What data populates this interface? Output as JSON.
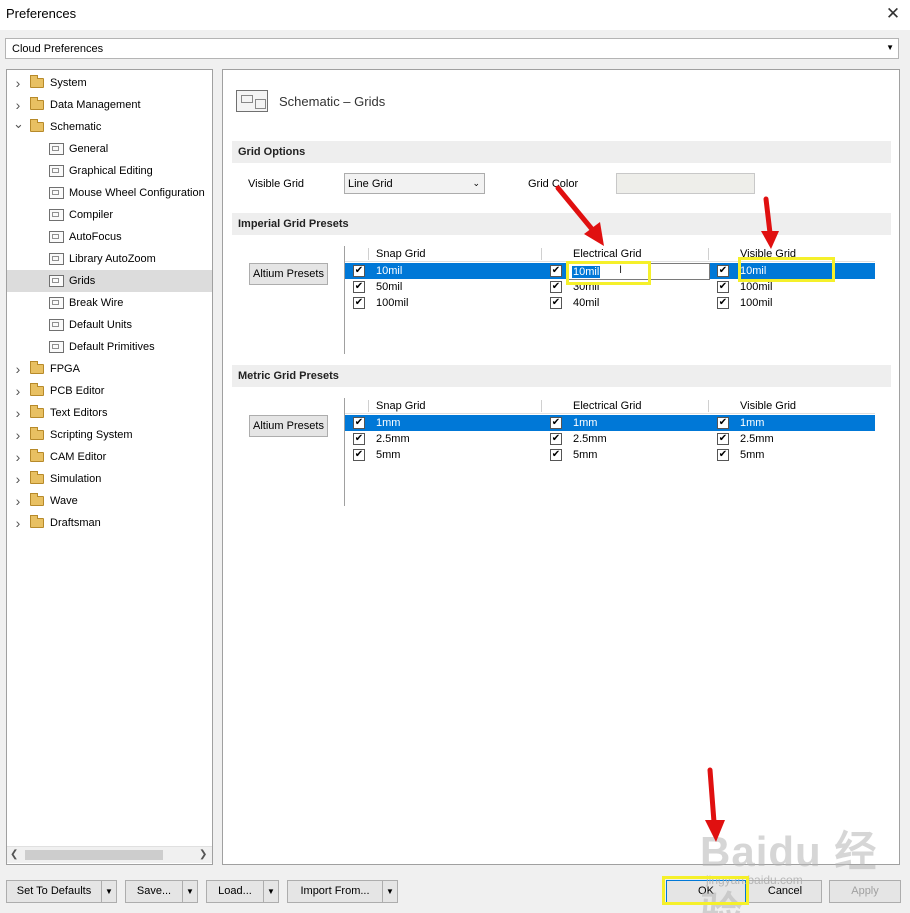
{
  "window": {
    "title": "Preferences",
    "close_glyph": "✕"
  },
  "cloud_select": {
    "value": "Cloud Preferences"
  },
  "tree": {
    "items": [
      {
        "label": "System",
        "level": 0,
        "expanded": false
      },
      {
        "label": "Data Management",
        "level": 0,
        "expanded": false
      },
      {
        "label": "Schematic",
        "level": 0,
        "expanded": true
      },
      {
        "label": "General",
        "level": 1
      },
      {
        "label": "Graphical Editing",
        "level": 1
      },
      {
        "label": "Mouse Wheel Configuration",
        "level": 1
      },
      {
        "label": "Compiler",
        "level": 1
      },
      {
        "label": "AutoFocus",
        "level": 1
      },
      {
        "label": "Library AutoZoom",
        "level": 1
      },
      {
        "label": "Grids",
        "level": 1,
        "selected": true
      },
      {
        "label": "Break Wire",
        "level": 1
      },
      {
        "label": "Default Units",
        "level": 1
      },
      {
        "label": "Default Primitives",
        "level": 1
      },
      {
        "label": "FPGA",
        "level": 0,
        "expanded": false
      },
      {
        "label": "PCB Editor",
        "level": 0,
        "expanded": false
      },
      {
        "label": "Text Editors",
        "level": 0,
        "expanded": false
      },
      {
        "label": "Scripting System",
        "level": 0,
        "expanded": false
      },
      {
        "label": "CAM Editor",
        "level": 0,
        "expanded": false
      },
      {
        "label": "Simulation",
        "level": 0,
        "expanded": false
      },
      {
        "label": "Wave",
        "level": 0,
        "expanded": false
      },
      {
        "label": "Draftsman",
        "level": 0,
        "expanded": false
      }
    ]
  },
  "page": {
    "title": "Schematic – Grids"
  },
  "grid_options": {
    "header": "Grid Options",
    "visible_grid_label": "Visible Grid",
    "visible_grid_value": "Line Grid",
    "grid_color_label": "Grid Color",
    "grid_color": "#eeeeea"
  },
  "imperial": {
    "header": "Imperial Grid Presets",
    "presets_button": "Altium Presets",
    "columns": [
      "Snap Grid",
      "Electrical Grid",
      "Visible Grid"
    ],
    "rows": [
      {
        "snap": "10mil",
        "electrical": "10mil",
        "visible": "10mil",
        "selected": true
      },
      {
        "snap": "50mil",
        "electrical": "30mil",
        "visible": "100mil"
      },
      {
        "snap": "100mil",
        "electrical": "40mil",
        "visible": "100mil"
      }
    ]
  },
  "metric": {
    "header": "Metric Grid Presets",
    "presets_button": "Altium Presets",
    "columns": [
      "Snap Grid",
      "Electrical Grid",
      "Visible Grid"
    ],
    "rows": [
      {
        "snap": "1mm",
        "electrical": "1mm",
        "visible": "1mm",
        "selected": true
      },
      {
        "snap": "2.5mm",
        "electrical": "2.5mm",
        "visible": "2.5mm"
      },
      {
        "snap": "5mm",
        "electrical": "5mm",
        "visible": "5mm"
      }
    ]
  },
  "buttons": {
    "set_defaults": "Set To Defaults",
    "save": "Save...",
    "load": "Load...",
    "import_from": "Import From...",
    "ok": "OK",
    "cancel": "Cancel",
    "apply": "Apply"
  },
  "watermark": {
    "text": "Baidu 经验",
    "url": "jingyan.baidu.com"
  },
  "colors": {
    "selection": "#0078d7",
    "highlight": "#f5f02a",
    "arrow": "#e01010"
  }
}
